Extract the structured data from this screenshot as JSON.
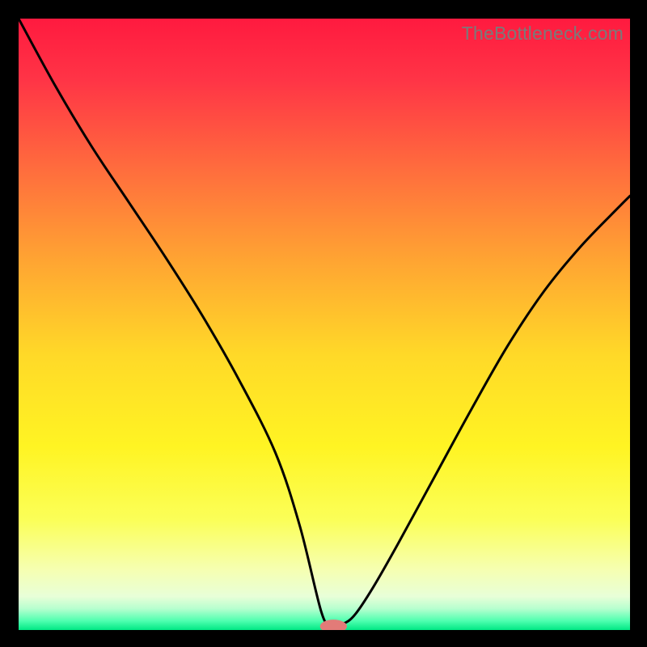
{
  "watermark": "TheBottleneck.com",
  "chart_data": {
    "type": "line",
    "title": "",
    "xlabel": "",
    "ylabel": "",
    "xlim": [
      0,
      100
    ],
    "ylim": [
      0,
      100
    ],
    "series": [
      {
        "name": "curve",
        "x": [
          0,
          6,
          12,
          18,
          24,
          30,
          36,
          42,
          46,
          49.5,
          51,
          53,
          55,
          58,
          62,
          68,
          74,
          80,
          86,
          92,
          98,
          100
        ],
        "y": [
          100,
          89,
          79,
          70,
          61,
          51.5,
          41,
          29,
          17,
          3,
          1,
          1,
          2.5,
          7,
          14,
          25,
          36,
          46.5,
          55.5,
          62.8,
          69,
          71
        ]
      }
    ],
    "marker": {
      "x": 51.5,
      "y": 0.6,
      "rx": 2.2,
      "ry": 1.1,
      "color": "#e27b78"
    },
    "gradient_stops": [
      {
        "offset": 0.0,
        "color": "#ff1a3f"
      },
      {
        "offset": 0.1,
        "color": "#ff3446"
      },
      {
        "offset": 0.25,
        "color": "#ff6e3d"
      },
      {
        "offset": 0.4,
        "color": "#ffa632"
      },
      {
        "offset": 0.55,
        "color": "#ffd928"
      },
      {
        "offset": 0.7,
        "color": "#fff423"
      },
      {
        "offset": 0.82,
        "color": "#fbff58"
      },
      {
        "offset": 0.9,
        "color": "#f6ffb0"
      },
      {
        "offset": 0.945,
        "color": "#e8ffd8"
      },
      {
        "offset": 0.965,
        "color": "#b7ffcf"
      },
      {
        "offset": 0.985,
        "color": "#4fffb0"
      },
      {
        "offset": 1.0,
        "color": "#00e884"
      }
    ]
  }
}
